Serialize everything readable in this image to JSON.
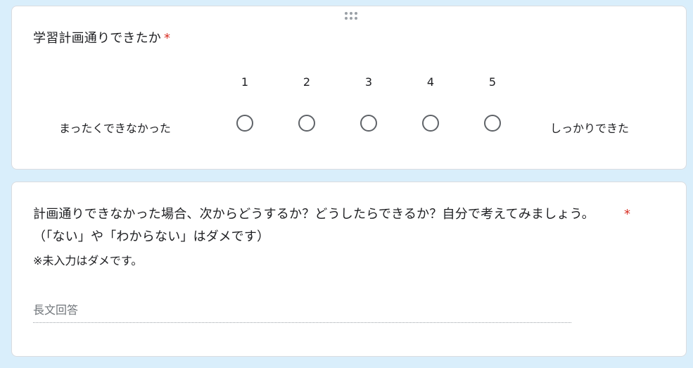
{
  "q1": {
    "title": "学習計画通りできたか",
    "required_mark": "*",
    "scale": [
      "1",
      "2",
      "3",
      "4",
      "5"
    ],
    "low_label": "まったくできなかった",
    "high_label": "しっかりできた"
  },
  "q2": {
    "title": "計画通りできなかった場合、次からどうするか？どうしたらできるか？自分で考えてみましょう。（「ない」や「わからない」はダメです）",
    "required_mark": "*",
    "description": "※未入力はダメです。",
    "placeholder": "長文回答"
  }
}
